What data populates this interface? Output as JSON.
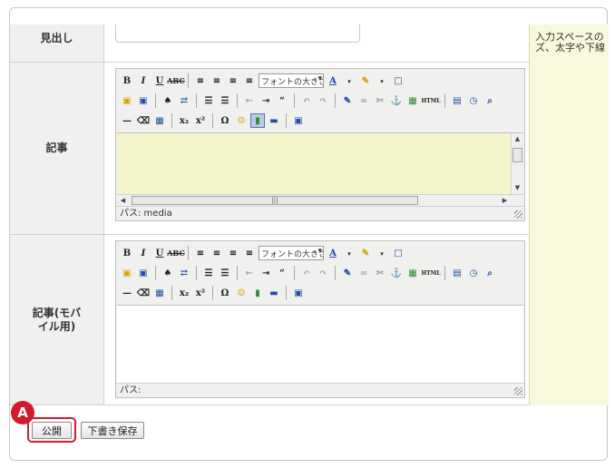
{
  "fields": {
    "title_label": "見出し",
    "article_label": "記事",
    "mobile_label": "記事(モバイル用)"
  },
  "side_note": {
    "line1": "入力スペースの",
    "line2": "ズ、太字や下線"
  },
  "editor": {
    "font_size_select": "フォントの大きさ",
    "article_path": "パス: media",
    "mobile_path": "パス:",
    "html_button": "HTML"
  },
  "buttons": {
    "publish": "公開",
    "save_draft": "下書き保存"
  },
  "annotation": {
    "marker": "A"
  },
  "colors": {
    "annotation_red": "#d21a2a",
    "edit_area_yellow": "#f5f5cc",
    "side_panel": "#f7f8dc"
  }
}
